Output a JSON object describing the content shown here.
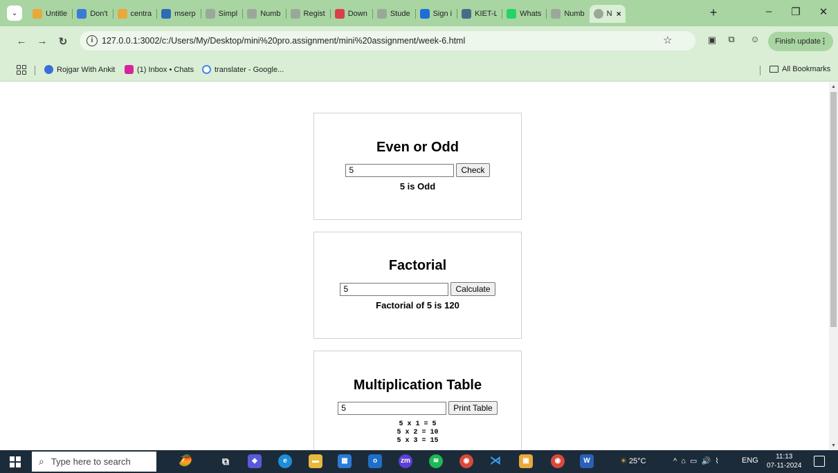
{
  "browser": {
    "tabs": [
      {
        "title": "Untitle",
        "icon": "folder-icon",
        "color": "#e8a93b"
      },
      {
        "title": "Don't",
        "icon": "flame-icon",
        "color": "#3a7bd5"
      },
      {
        "title": "centra",
        "icon": "folder-icon",
        "color": "#e8a93b"
      },
      {
        "title": "mserp",
        "icon": "erp-icon",
        "color": "#2d6db5"
      },
      {
        "title": "Simpl",
        "icon": "globe-icon",
        "color": "#9aa89a"
      },
      {
        "title": "Numb",
        "icon": "globe-icon",
        "color": "#9aa89a"
      },
      {
        "title": "Regist",
        "icon": "globe-icon",
        "color": "#9aa89a"
      },
      {
        "title": "Down",
        "icon": "heart-icon",
        "color": "#d8404a"
      },
      {
        "title": "Stude",
        "icon": "globe-icon",
        "color": "#9aa89a"
      },
      {
        "title": "Sign i",
        "icon": "s-logo-icon",
        "color": "#1e6ed8"
      },
      {
        "title": "KIET-L",
        "icon": "kiet-icon",
        "color": "#4a6a8a"
      },
      {
        "title": "Whats",
        "icon": "whatsapp-icon",
        "color": "#25d366"
      },
      {
        "title": "Numb",
        "icon": "globe-icon",
        "color": "#9aa89a"
      }
    ],
    "active_tab": {
      "title": "N",
      "close": "×"
    },
    "new_tab": "+",
    "window_controls": {
      "minimize": "–",
      "restore": "❐",
      "close": "✕"
    },
    "url": "127.0.0.1:3002/c:/Users/My/Desktop/mini%20pro.assignment/mini%20assignment/week-6.html",
    "update_button": "Finish update",
    "bookmarks": [
      {
        "label": "Rojgar With Ankit",
        "color": "#3a6fd8"
      },
      {
        "label": "(1) Inbox • Chats",
        "color": "#d6249f"
      },
      {
        "label": "translater - Google...",
        "color": "#4285f4"
      }
    ],
    "all_bookmarks": "All Bookmarks"
  },
  "page": {
    "even_odd": {
      "title": "Even or Odd",
      "input_value": "5",
      "button": "Check",
      "result": "5 is Odd"
    },
    "factorial": {
      "title": "Factorial",
      "input_value": "5",
      "button": "Calculate",
      "result": "Factorial of 5 is 120"
    },
    "multiplication": {
      "title": "Multiplication Table",
      "input_value": "5",
      "button": "Print Table",
      "lines": [
        "5 x 1 = 5",
        "5 x 2 = 10",
        "5 x 3 = 15"
      ]
    }
  },
  "taskbar": {
    "search_placeholder": "Type here to search",
    "weather": "25°C",
    "language": "ENG",
    "time": "11:13",
    "date": "07-11-2024"
  }
}
